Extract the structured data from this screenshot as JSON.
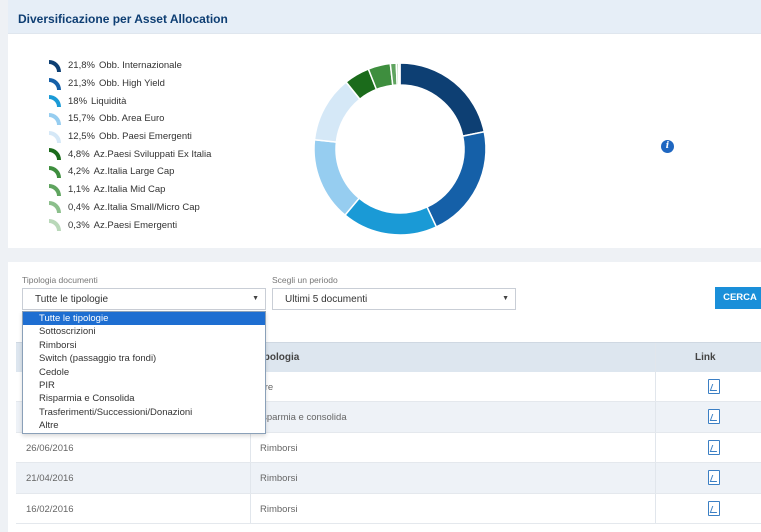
{
  "allocation": {
    "title": "Diversificazione per Asset Allocation",
    "items": [
      {
        "pct": "21,8%",
        "label": "Obb. Internazionale",
        "value": 21.8,
        "color": "#0d3f73"
      },
      {
        "pct": "21,3%",
        "label": "Obb. High Yield",
        "value": 21.3,
        "color": "#1560a8"
      },
      {
        "pct": "18%",
        "label": "Liquidità",
        "value": 18.0,
        "color": "#1a9ad6"
      },
      {
        "pct": "15,7%",
        "label": "Obb. Area Euro",
        "value": 15.7,
        "color": "#96cdf0"
      },
      {
        "pct": "12,5%",
        "label": "Obb. Paesi Emergenti",
        "value": 12.5,
        "color": "#d5e8f7"
      },
      {
        "pct": "4,8%",
        "label": "Az.Paesi Sviluppati Ex Italia",
        "value": 4.8,
        "color": "#1b6b1b"
      },
      {
        "pct": "4,2%",
        "label": "Az.Italia Large Cap",
        "value": 4.2,
        "color": "#3e8e3e"
      },
      {
        "pct": "1,1%",
        "label": "Az.Italia Mid Cap",
        "value": 1.1,
        "color": "#5fa45f"
      },
      {
        "pct": "0,4%",
        "label": "Az.Italia Small/Micro Cap",
        "value": 0.4,
        "color": "#8cbf8c"
      },
      {
        "pct": "0,3%",
        "label": "Az.Paesi Emergenti",
        "value": 0.3,
        "color": "#b9d8b9"
      }
    ]
  },
  "filters": {
    "tipologia_label": "Tipologia documenti",
    "tipologia_value": "Tutte le tipologie",
    "periodo_label": "Scegli un periodo",
    "periodo_value": "Ultimi 5 documenti",
    "search_button": "CERCA"
  },
  "dropdown_options": [
    "Tutte le tipologie",
    "Sottoscrizioni",
    "Rimborsi",
    "Switch (passaggio tra fondi)",
    "Cedole",
    "PIR",
    "Risparmia e Consolida",
    "Trasferimenti/Successioni/Donazioni",
    "Altre"
  ],
  "table": {
    "col_tipologia": "ipologia",
    "col_link": "Link",
    "rows": [
      {
        "date": "",
        "tipologia": "ltre"
      },
      {
        "date": "",
        "tipologia": "isparmia e consolida"
      },
      {
        "date": "26/06/2016",
        "tipologia": "Rimborsi"
      },
      {
        "date": "21/04/2016",
        "tipologia": "Rimborsi"
      },
      {
        "date": "16/02/2016",
        "tipologia": "Rimborsi"
      }
    ]
  }
}
